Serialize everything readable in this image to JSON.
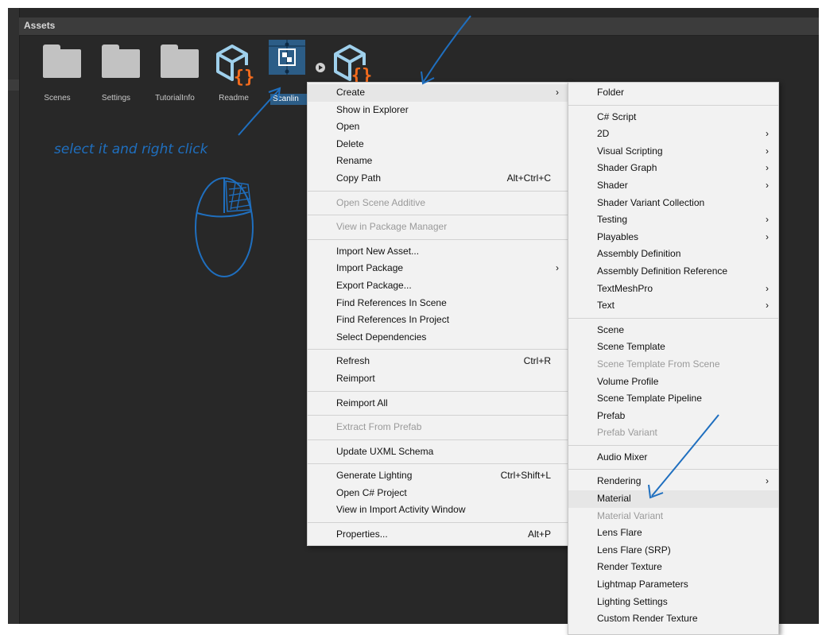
{
  "panel": {
    "title": "Assets"
  },
  "assets": [
    {
      "name": "Scenes",
      "type": "folder"
    },
    {
      "name": "Settings",
      "type": "folder"
    },
    {
      "name": "TutorialInfo",
      "type": "folder"
    },
    {
      "name": "Readme",
      "type": "readme-asset"
    },
    {
      "name": "Scanlin",
      "type": "selected-asset"
    },
    {
      "name": "",
      "type": "script-asset"
    }
  ],
  "annotation": {
    "text": "select it and right click",
    "color": "#1f6fbf"
  },
  "context_menu": {
    "items": [
      {
        "label": "Create",
        "submenu": true,
        "highlighted": true
      },
      {
        "label": "Show in Explorer"
      },
      {
        "label": "Open"
      },
      {
        "label": "Delete"
      },
      {
        "label": "Rename"
      },
      {
        "label": "Copy Path",
        "shortcut": "Alt+Ctrl+C"
      },
      {
        "separator": true
      },
      {
        "label": "Open Scene Additive",
        "disabled": true
      },
      {
        "separator": true
      },
      {
        "label": "View in Package Manager",
        "disabled": true
      },
      {
        "separator": true
      },
      {
        "label": "Import New Asset..."
      },
      {
        "label": "Import Package",
        "submenu": true
      },
      {
        "label": "Export Package..."
      },
      {
        "label": "Find References In Scene"
      },
      {
        "label": "Find References In Project"
      },
      {
        "label": "Select Dependencies"
      },
      {
        "separator": true
      },
      {
        "label": "Refresh",
        "shortcut": "Ctrl+R"
      },
      {
        "label": "Reimport"
      },
      {
        "separator": true
      },
      {
        "label": "Reimport All"
      },
      {
        "separator": true
      },
      {
        "label": "Extract From Prefab",
        "disabled": true
      },
      {
        "separator": true
      },
      {
        "label": "Update UXML Schema"
      },
      {
        "separator": true
      },
      {
        "label": "Generate Lighting",
        "shortcut": "Ctrl+Shift+L"
      },
      {
        "label": "Open C# Project"
      },
      {
        "label": "View in Import Activity Window"
      },
      {
        "separator": true
      },
      {
        "label": "Properties...",
        "shortcut": "Alt+P"
      }
    ]
  },
  "create_submenu": {
    "items": [
      {
        "label": "Folder"
      },
      {
        "separator": true
      },
      {
        "label": "C# Script"
      },
      {
        "label": "2D",
        "submenu": true
      },
      {
        "label": "Visual Scripting",
        "submenu": true
      },
      {
        "label": "Shader Graph",
        "submenu": true
      },
      {
        "label": "Shader",
        "submenu": true
      },
      {
        "label": "Shader Variant Collection"
      },
      {
        "label": "Testing",
        "submenu": true
      },
      {
        "label": "Playables",
        "submenu": true
      },
      {
        "label": "Assembly Definition"
      },
      {
        "label": "Assembly Definition Reference"
      },
      {
        "label": "TextMeshPro",
        "submenu": true
      },
      {
        "label": "Text",
        "submenu": true
      },
      {
        "separator": true
      },
      {
        "label": "Scene"
      },
      {
        "label": "Scene Template"
      },
      {
        "label": "Scene Template From Scene",
        "disabled": true
      },
      {
        "label": "Volume Profile"
      },
      {
        "label": "Scene Template Pipeline"
      },
      {
        "label": "Prefab"
      },
      {
        "label": "Prefab Variant",
        "disabled": true
      },
      {
        "separator": true
      },
      {
        "label": "Audio Mixer"
      },
      {
        "separator": true
      },
      {
        "label": "Rendering",
        "submenu": true
      },
      {
        "label": "Material",
        "highlighted": true
      },
      {
        "label": "Material Variant",
        "disabled": true
      },
      {
        "label": "Lens Flare"
      },
      {
        "label": "Lens Flare (SRP)"
      },
      {
        "label": "Render Texture"
      },
      {
        "label": "Lightmap Parameters"
      },
      {
        "label": "Lighting Settings"
      },
      {
        "label": "Custom Render Texture"
      }
    ]
  }
}
